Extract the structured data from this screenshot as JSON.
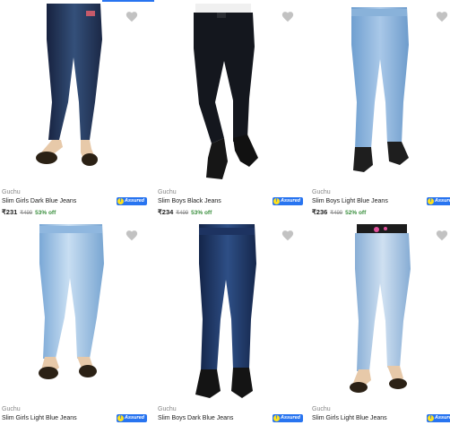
{
  "colors": {
    "accent": "#2874f0",
    "discount": "#388e3c",
    "wishlist": "#c2c2c2",
    "secondary_text": "#878787"
  },
  "wishlist_icon": "heart-icon",
  "assured_badge": {
    "label": "Assured",
    "letter": "f"
  },
  "products": [
    {
      "brand": "Guchu",
      "title": "Slim Girls Dark Blue Jeans",
      "price": "₹231",
      "mrp": "₹499",
      "discount": "53% off",
      "assured": true,
      "style": "girls-dark"
    },
    {
      "brand": "Guchu",
      "title": "Slim Boys Black Jeans",
      "price": "₹234",
      "mrp": "₹499",
      "discount": "53% off",
      "assured": true,
      "style": "boys-black"
    },
    {
      "brand": "Guchu",
      "title": "Slim Boys Light Blue Jeans",
      "price": "₹236",
      "mrp": "₹499",
      "discount": "52% off",
      "assured": true,
      "style": "boys-light"
    },
    {
      "brand": "Guchu",
      "title": "Slim Girls Light Blue Jeans",
      "price": "",
      "mrp": "",
      "discount": "",
      "assured": true,
      "style": "girls-light"
    },
    {
      "brand": "Guchu",
      "title": "Slim Boys Dark Blue Jeans",
      "price": "",
      "mrp": "",
      "discount": "",
      "assured": true,
      "style": "boys-dark"
    },
    {
      "brand": "Guchu",
      "title": "Slim Girls Light Blue Jeans",
      "price": "",
      "mrp": "",
      "discount": "",
      "assured": true,
      "style": "girls-light2"
    }
  ]
}
